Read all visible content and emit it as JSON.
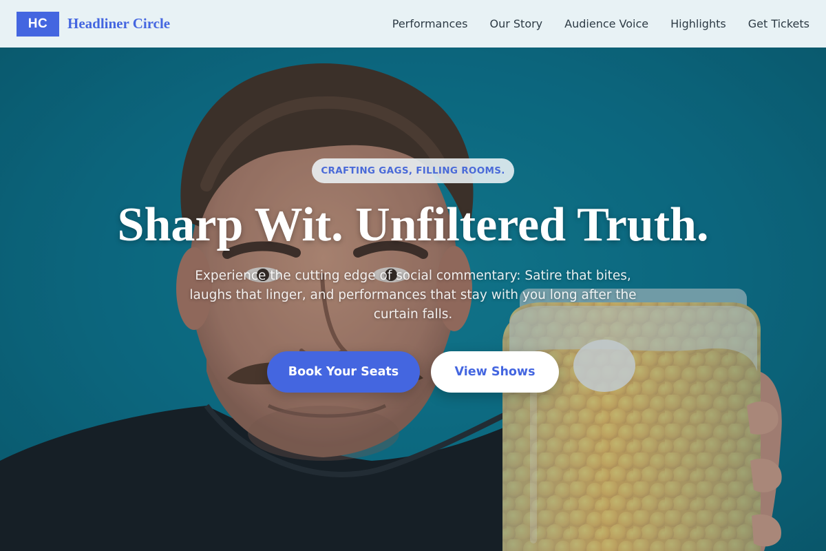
{
  "brand": {
    "badge": "HC",
    "name": "Headliner Circle",
    "accent_color": "#4466e0"
  },
  "nav": {
    "items": [
      {
        "label": "Performances"
      },
      {
        "label": "Our Story"
      },
      {
        "label": "Audience Voice"
      },
      {
        "label": "Highlights"
      },
      {
        "label": "Get Tickets"
      }
    ]
  },
  "hero": {
    "tagline": "CRAFTING GAGS, FILLING ROOMS.",
    "title": "Sharp Wit. Unfiltered Truth.",
    "subtitle": "Experience the cutting edge of social commentary: Satire that bites, laughs that linger, and performances that stay with you long after the curtain falls.",
    "primary_button": "Book Your Seats",
    "secondary_button": "View Shows",
    "background_color": "#0d7790",
    "image": "man-with-mustache-holding-jar-of-cheese-puffs"
  }
}
